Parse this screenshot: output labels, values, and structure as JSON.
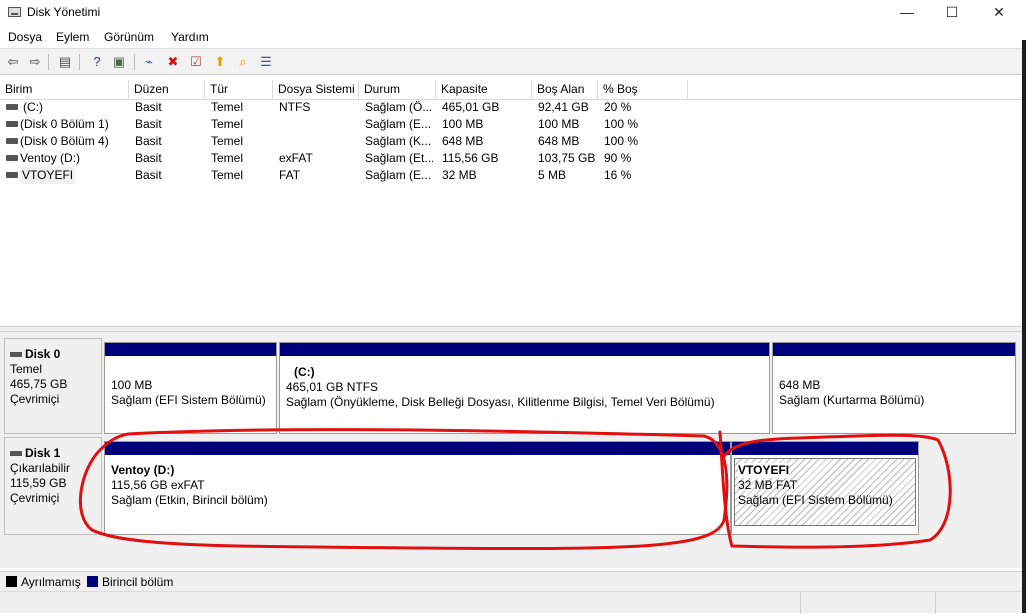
{
  "window": {
    "title": "Disk Yönetimi",
    "icon": "disk-management-icon",
    "controls": {
      "minimize": "—",
      "maximize": "☐",
      "close": "✕"
    }
  },
  "menu": [
    "Dosya",
    "Eylem",
    "Görünüm",
    "Yardım"
  ],
  "toolbar": {
    "buttons": [
      {
        "name": "back-icon",
        "glyph": "⇦",
        "color": "#3a3a3a"
      },
      {
        "name": "forward-icon",
        "glyph": "⇨",
        "color": "#3a3a3a"
      },
      {
        "name": "console-tree-icon",
        "glyph": "▤",
        "color": "#4a4a4a"
      },
      {
        "name": "help-icon",
        "glyph": "?",
        "color": "#1f3f9f"
      },
      {
        "name": "properties-icon",
        "glyph": "▣",
        "color": "#4a6a4a"
      },
      {
        "name": "connect-drive-icon",
        "glyph": "⌁",
        "color": "#3a5a8a"
      },
      {
        "name": "delete-icon",
        "glyph": "✖",
        "color": "#d01010"
      },
      {
        "name": "check-icon",
        "glyph": "☑",
        "color": "#b04040"
      },
      {
        "name": "import-icon",
        "glyph": "⬆",
        "color": "#d9a400"
      },
      {
        "name": "search-folder-icon",
        "glyph": "⌕",
        "color": "#c89a00"
      },
      {
        "name": "list-view-icon",
        "glyph": "☰",
        "color": "#3a5a8a"
      }
    ]
  },
  "volume_list": {
    "columns": [
      "Birim",
      "Düzen",
      "Tür",
      "Dosya Sistemi",
      "Durum",
      "Kapasite",
      "Boş Alan",
      "% Boş"
    ],
    "rows": [
      {
        "birim": "(C:)",
        "duzen": "Basit",
        "tur": "Temel",
        "dosya_sistemi": "NTFS",
        "durum": "Sağlam (Ö...",
        "kapasite": "465,01 GB",
        "bos_alan": "92,41 GB",
        "yuzde_bos": "20 %"
      },
      {
        "birim": "(Disk 0 Bölüm 1)",
        "duzen": "Basit",
        "tur": "Temel",
        "dosya_sistemi": "",
        "durum": "Sağlam (E...",
        "kapasite": "100 MB",
        "bos_alan": "100 MB",
        "yuzde_bos": "100 %"
      },
      {
        "birim": "(Disk 0 Bölüm 4)",
        "duzen": "Basit",
        "tur": "Temel",
        "dosya_sistemi": "",
        "durum": "Sağlam (K...",
        "kapasite": "648 MB",
        "bos_alan": "648 MB",
        "yuzde_bos": "100 %"
      },
      {
        "birim": "Ventoy (D:)",
        "duzen": "Basit",
        "tur": "Temel",
        "dosya_sistemi": "exFAT",
        "durum": "Sağlam (Et...",
        "kapasite": "115,56 GB",
        "bos_alan": "103,75 GB",
        "yuzde_bos": "90 %"
      },
      {
        "birim": "VTOYEFI",
        "duzen": "Basit",
        "tur": "Temel",
        "dosya_sistemi": "FAT",
        "durum": "Sağlam (E...",
        "kapasite": "32 MB",
        "bos_alan": "5 MB",
        "yuzde_bos": "16 %"
      }
    ]
  },
  "disks": [
    {
      "name": "Disk 0",
      "type": "Temel",
      "size": "465,75 GB",
      "status": "Çevrimiçi",
      "partitions": [
        {
          "title": "",
          "size": "100 MB",
          "status": "Sağlam (EFI Sistem Bölümü)"
        },
        {
          "title": "(C:)",
          "size": "465,01 GB NTFS",
          "status": "Sağlam (Önyükleme, Disk Belleği Dosyası, Kilitlenme Bilgisi, Temel Veri Bölümü)"
        },
        {
          "title": "",
          "size": "648 MB",
          "status": "Sağlam (Kurtarma Bölümü)"
        }
      ]
    },
    {
      "name": "Disk 1",
      "type": "Çıkarılabilir",
      "size": "115,59 GB",
      "status": "Çevrimiçi",
      "partitions": [
        {
          "title": "Ventoy  (D:)",
          "size": "115,56 GB exFAT",
          "status": "Sağlam (Etkin, Birincil bölüm)"
        },
        {
          "title": "VTOYEFI",
          "size": "32 MB FAT",
          "status": "Sağlam (EFI Sistem Bölümü)"
        }
      ]
    }
  ],
  "legend": [
    {
      "label": "Ayrılmamış",
      "color": "#000000"
    },
    {
      "label": "Birincil bölüm",
      "color": "#00007a"
    }
  ],
  "colors": {
    "partition_bar": "#00007a",
    "annotation": "#e01010"
  }
}
